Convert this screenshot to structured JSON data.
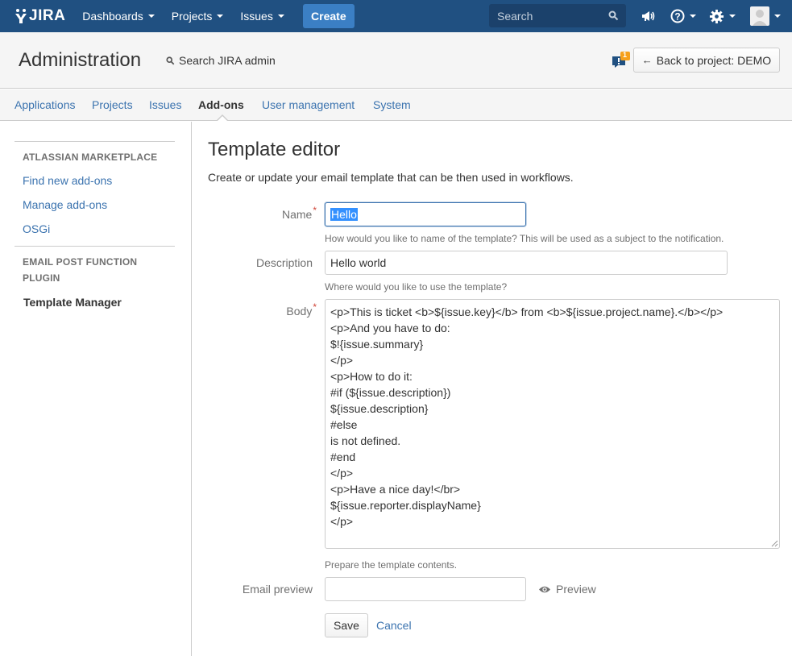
{
  "topnav": {
    "logo_text": "JIRA",
    "menus": [
      {
        "label": "Dashboards"
      },
      {
        "label": "Projects"
      },
      {
        "label": "Issues"
      }
    ],
    "create_label": "Create",
    "search_placeholder": "Search",
    "icons": [
      "notifications-megaphone-icon",
      "help-icon",
      "settings-gear-icon",
      "user-avatar-icon"
    ]
  },
  "admin": {
    "title": "Administration",
    "search_label": "Search JIRA admin",
    "notification_count": "1",
    "back_label": "Back to project: DEMO"
  },
  "tabs": [
    {
      "label": "Applications",
      "active": false
    },
    {
      "label": "Projects",
      "active": false
    },
    {
      "label": "Issues",
      "active": false
    },
    {
      "label": "Add-ons",
      "active": true
    },
    {
      "label": "User management",
      "active": false
    },
    {
      "label": "System",
      "active": false
    }
  ],
  "sidebar": {
    "section1_heading": "ATLASSIAN MARKETPLACE",
    "section1_items": [
      "Find new add-ons",
      "Manage add-ons",
      "OSGi"
    ],
    "section2_heading_line1": "EMAIL POST FUNCTION",
    "section2_heading_line2": "PLUGIN",
    "section2_current": "Template Manager"
  },
  "form": {
    "heading": "Template editor",
    "description": "Create or update your email template that can be then used in workflows.",
    "name_label": "Name",
    "name_value": "Hello",
    "name_hint": "How would you like to name of the template? This will be used as a subject to the notification.",
    "description_label": "Description",
    "description_value": "Hello world",
    "description_hint": "Where would you like to use the template?",
    "body_label": "Body",
    "body_value": "<p>This is ticket <b>${issue.key}</b> from <b>${issue.project.name}.</b></p>\n<p>And you have to do:\n$!{issue.summary}\n</p>\n<p>How to do it:\n#if (${issue.description})\n${issue.description}\n#else\nis not defined.\n#end\n</p>\n<p>Have a nice day!</br>\n${issue.reporter.displayName}\n</p>",
    "body_hint": "Prepare the template contents.",
    "email_preview_label": "Email preview",
    "email_preview_value": "",
    "preview_label": "Preview",
    "save_label": "Save",
    "cancel_label": "Cancel"
  },
  "colors": {
    "header_bg": "#205081",
    "create_button": "#3b7fc4",
    "link": "#3b73af",
    "required": "#d04437",
    "notification_badge": "#f6a01a"
  }
}
